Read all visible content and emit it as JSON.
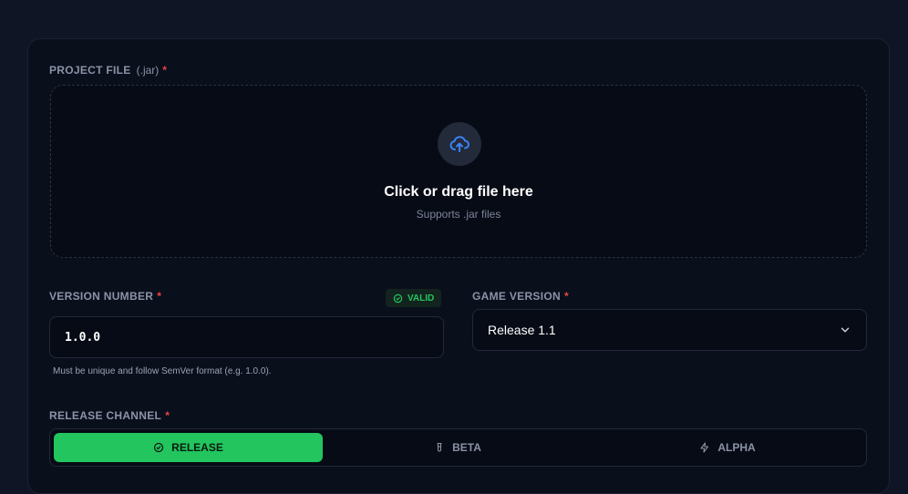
{
  "project_file": {
    "label": "PROJECT FILE",
    "extension": "(.jar)",
    "required_mark": "*",
    "dropzone_title": "Click or drag file here",
    "dropzone_subtitle": "Supports .jar files",
    "icon": "cloud-upload-icon"
  },
  "version_number": {
    "label": "VERSION NUMBER",
    "required_mark": "*",
    "badge": "VALID",
    "value": "1.0.0",
    "hint": "Must be unique and follow SemVer format (e.g. 1.0.0)."
  },
  "game_version": {
    "label": "GAME VERSION",
    "required_mark": "*",
    "selected": "Release 1.1"
  },
  "release_channel": {
    "label": "RELEASE CHANNEL",
    "required_mark": "*",
    "options": [
      {
        "label": "RELEASE",
        "icon": "check-circle-icon",
        "active": true
      },
      {
        "label": "BETA",
        "icon": "flask-icon",
        "active": false
      },
      {
        "label": "ALPHA",
        "icon": "lightning-icon",
        "active": false
      }
    ]
  },
  "colors": {
    "accent": "#22c55e",
    "upload_icon": "#3b82f6",
    "required": "#ef4444"
  }
}
